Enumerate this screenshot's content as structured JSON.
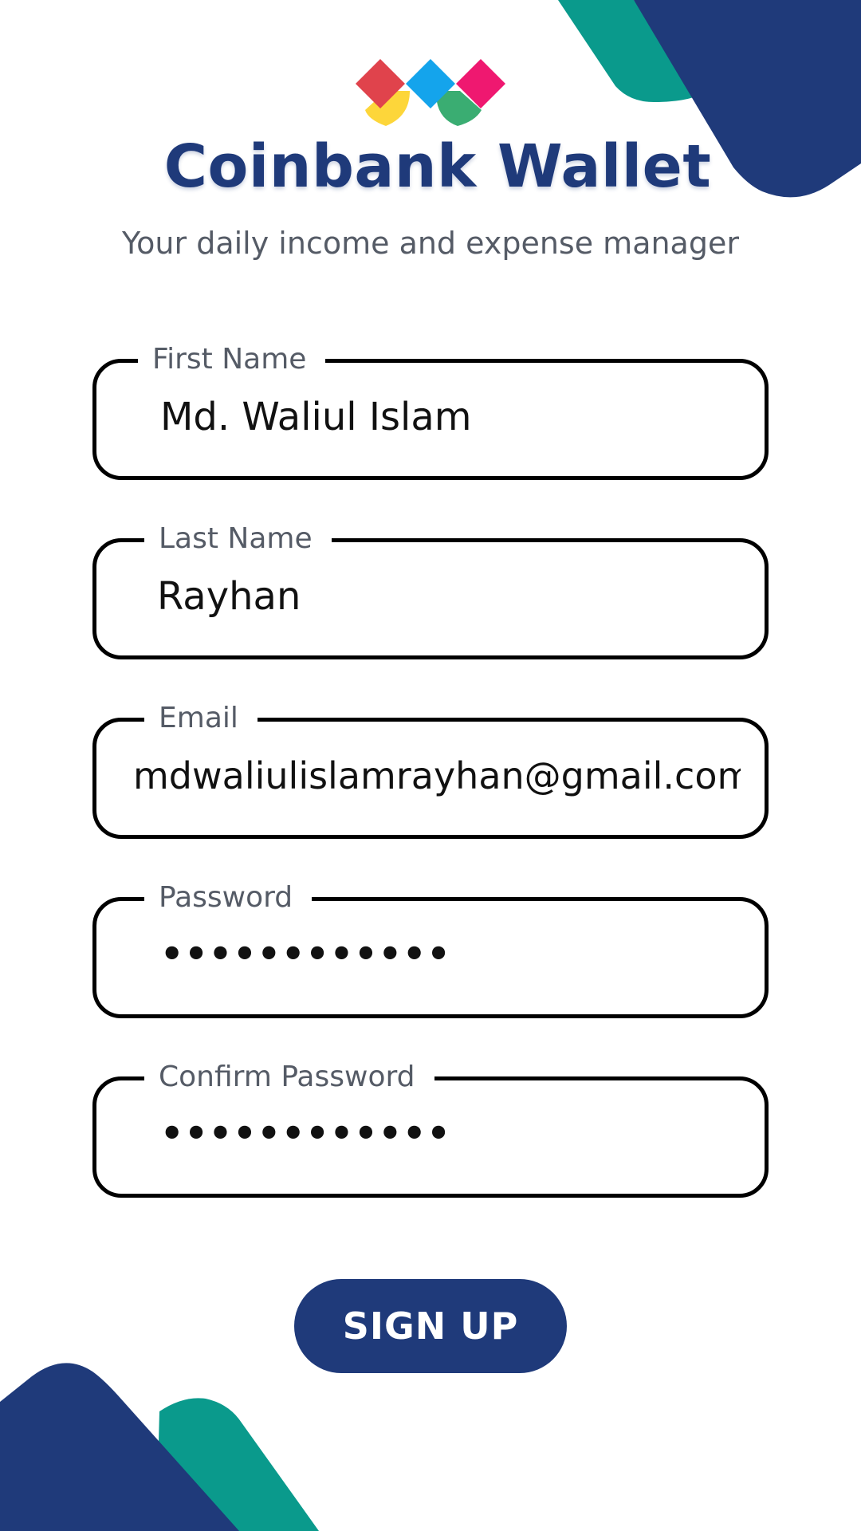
{
  "app": {
    "title": "Coinbank Wallet",
    "subtitle": "Your daily income and expense manager"
  },
  "form": {
    "first_name": {
      "label": "First Name",
      "value": "Md. Waliul Islam"
    },
    "last_name": {
      "label": "Last Name",
      "value": "Rayhan"
    },
    "email": {
      "label": "Email",
      "value": "mdwaliulislamrayhan@gmail.com"
    },
    "password": {
      "label": "Password",
      "value": "••••••••••••"
    },
    "confirm_password": {
      "label": "Confirm Password",
      "value": "••••••••••••"
    }
  },
  "actions": {
    "signup_label": "SIGN UP"
  },
  "colors": {
    "brand_navy": "#1f3a7a",
    "accent_teal": "#0a9a8c",
    "logo_red": "#e0434c",
    "logo_blue": "#14a4ec",
    "logo_pink": "#ef1870",
    "logo_yellow": "#fdd63a",
    "logo_green": "#3aad72"
  }
}
